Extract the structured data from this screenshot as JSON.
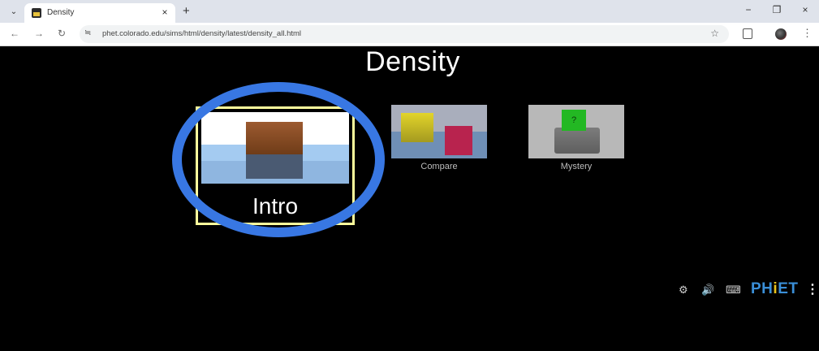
{
  "browser": {
    "tab_title": "Density",
    "tab_close": "×",
    "new_tab": "+",
    "tab_list": "⌄",
    "window": {
      "minimize": "−",
      "restore": "❐",
      "close": "×"
    },
    "nav": {
      "back": "←",
      "forward": "→",
      "reload": "↻"
    },
    "site_info_icon": "≒",
    "url": "phet.colorado.edu/sims/html/density/latest/density_all.html",
    "bookmark": "☆",
    "menu": "⋮"
  },
  "sim": {
    "title": "Density",
    "screens": [
      {
        "label": "Intro",
        "selected": true
      },
      {
        "label": "Compare",
        "selected": false
      },
      {
        "label": "Mystery",
        "selected": false
      }
    ],
    "mystery_block_mark": "?",
    "nav_bar": {
      "settings_icon": "⚙",
      "sound_icon": "🔊",
      "keyboard_icon": "⌨",
      "logo": {
        "p": "PH",
        "i": "i",
        "rest": "ET"
      },
      "menu": "⋮"
    }
  },
  "colors": {
    "highlight_ring": "#3877e3",
    "selected_border": "#ffff9c",
    "background": "#000000",
    "phet_blue": "#3a8fd8",
    "phet_yellow": "#e8c21b"
  }
}
